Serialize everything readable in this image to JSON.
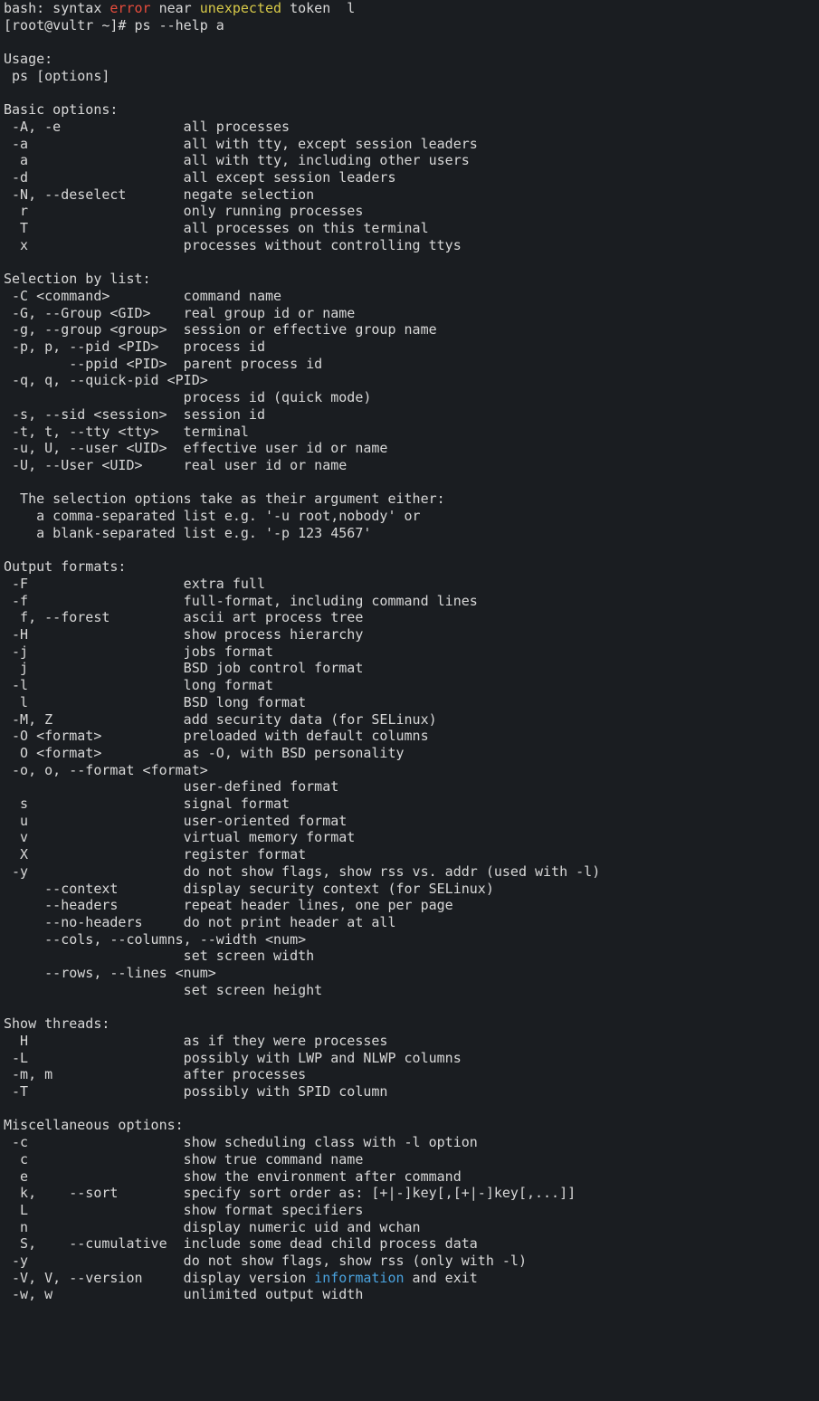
{
  "lines": [
    {
      "segments": [
        {
          "text": "bash: syntax "
        },
        {
          "text": "error",
          "class": "err-red"
        },
        {
          "text": " near "
        },
        {
          "text": "unexpected",
          "class": "warn-yellow"
        },
        {
          "text": " token  l"
        }
      ]
    },
    {
      "segments": [
        {
          "text": "[root@vultr ~]# ps --help a"
        }
      ]
    },
    {
      "segments": [
        {
          "text": ""
        }
      ]
    },
    {
      "segments": [
        {
          "text": "Usage:"
        }
      ]
    },
    {
      "segments": [
        {
          "text": " ps [options]"
        }
      ]
    },
    {
      "segments": [
        {
          "text": ""
        }
      ]
    },
    {
      "segments": [
        {
          "text": "Basic options:"
        }
      ]
    },
    {
      "segments": [
        {
          "text": " -A, -e               all processes"
        }
      ]
    },
    {
      "segments": [
        {
          "text": " -a                   all with tty, except session leaders"
        }
      ]
    },
    {
      "segments": [
        {
          "text": "  a                   all with tty, including other users"
        }
      ]
    },
    {
      "segments": [
        {
          "text": " -d                   all except session leaders"
        }
      ]
    },
    {
      "segments": [
        {
          "text": " -N, --deselect       negate selection"
        }
      ]
    },
    {
      "segments": [
        {
          "text": "  r                   only running processes"
        }
      ]
    },
    {
      "segments": [
        {
          "text": "  T                   all processes on this terminal"
        }
      ]
    },
    {
      "segments": [
        {
          "text": "  x                   processes without controlling ttys"
        }
      ]
    },
    {
      "segments": [
        {
          "text": ""
        }
      ]
    },
    {
      "segments": [
        {
          "text": "Selection by list:"
        }
      ]
    },
    {
      "segments": [
        {
          "text": " -C <command>         command name"
        }
      ]
    },
    {
      "segments": [
        {
          "text": " -G, --Group <GID>    real group id or name"
        }
      ]
    },
    {
      "segments": [
        {
          "text": " -g, --group <group>  session or effective group name"
        }
      ]
    },
    {
      "segments": [
        {
          "text": " -p, p, --pid <PID>   process id"
        }
      ]
    },
    {
      "segments": [
        {
          "text": "        --ppid <PID>  parent process id"
        }
      ]
    },
    {
      "segments": [
        {
          "text": " -q, q, --quick-pid <PID>"
        }
      ]
    },
    {
      "segments": [
        {
          "text": "                      process id (quick mode)"
        }
      ]
    },
    {
      "segments": [
        {
          "text": " -s, --sid <session>  session id"
        }
      ]
    },
    {
      "segments": [
        {
          "text": " -t, t, --tty <tty>   terminal"
        }
      ]
    },
    {
      "segments": [
        {
          "text": " -u, U, --user <UID>  effective user id or name"
        }
      ]
    },
    {
      "segments": [
        {
          "text": " -U, --User <UID>     real user id or name"
        }
      ]
    },
    {
      "segments": [
        {
          "text": ""
        }
      ]
    },
    {
      "segments": [
        {
          "text": "  The selection options take as their argument either:"
        }
      ]
    },
    {
      "segments": [
        {
          "text": "    a comma-separated list e.g. '-u root,nobody' or"
        }
      ]
    },
    {
      "segments": [
        {
          "text": "    a blank-separated list e.g. '-p 123 4567'"
        }
      ]
    },
    {
      "segments": [
        {
          "text": ""
        }
      ]
    },
    {
      "segments": [
        {
          "text": "Output formats:"
        }
      ]
    },
    {
      "segments": [
        {
          "text": " -F                   extra full"
        }
      ]
    },
    {
      "segments": [
        {
          "text": " -f                   full-format, including command lines"
        }
      ]
    },
    {
      "segments": [
        {
          "text": "  f, --forest         ascii art process tree"
        }
      ]
    },
    {
      "segments": [
        {
          "text": " -H                   show process hierarchy"
        }
      ]
    },
    {
      "segments": [
        {
          "text": " -j                   jobs format"
        }
      ]
    },
    {
      "segments": [
        {
          "text": "  j                   BSD job control format"
        }
      ]
    },
    {
      "segments": [
        {
          "text": " -l                   long format"
        }
      ]
    },
    {
      "segments": [
        {
          "text": "  l                   BSD long format"
        }
      ]
    },
    {
      "segments": [
        {
          "text": " -M, Z                add security data (for SELinux)"
        }
      ]
    },
    {
      "segments": [
        {
          "text": " -O <format>          preloaded with default columns"
        }
      ]
    },
    {
      "segments": [
        {
          "text": "  O <format>          as -O, with BSD personality"
        }
      ]
    },
    {
      "segments": [
        {
          "text": " -o, o, --format <format>"
        }
      ]
    },
    {
      "segments": [
        {
          "text": "                      user-defined format"
        }
      ]
    },
    {
      "segments": [
        {
          "text": "  s                   signal format"
        }
      ]
    },
    {
      "segments": [
        {
          "text": "  u                   user-oriented format"
        }
      ]
    },
    {
      "segments": [
        {
          "text": "  v                   virtual memory format"
        }
      ]
    },
    {
      "segments": [
        {
          "text": "  X                   register format"
        }
      ]
    },
    {
      "segments": [
        {
          "text": " -y                   do not show flags, show rss vs. addr (used with -l)"
        }
      ]
    },
    {
      "segments": [
        {
          "text": "     --context        display security context (for SELinux)"
        }
      ]
    },
    {
      "segments": [
        {
          "text": "     --headers        repeat header lines, one per page"
        }
      ]
    },
    {
      "segments": [
        {
          "text": "     --no-headers     do not print header at all"
        }
      ]
    },
    {
      "segments": [
        {
          "text": "     --cols, --columns, --width <num>"
        }
      ]
    },
    {
      "segments": [
        {
          "text": "                      set screen width"
        }
      ]
    },
    {
      "segments": [
        {
          "text": "     --rows, --lines <num>"
        }
      ]
    },
    {
      "segments": [
        {
          "text": "                      set screen height"
        }
      ]
    },
    {
      "segments": [
        {
          "text": ""
        }
      ]
    },
    {
      "segments": [
        {
          "text": "Show threads:"
        }
      ]
    },
    {
      "segments": [
        {
          "text": "  H                   as if they were processes"
        }
      ]
    },
    {
      "segments": [
        {
          "text": " -L                   possibly with LWP and NLWP columns"
        }
      ]
    },
    {
      "segments": [
        {
          "text": " -m, m                after processes"
        }
      ]
    },
    {
      "segments": [
        {
          "text": " -T                   possibly with SPID column"
        }
      ]
    },
    {
      "segments": [
        {
          "text": ""
        }
      ]
    },
    {
      "segments": [
        {
          "text": "Miscellaneous options:"
        }
      ]
    },
    {
      "segments": [
        {
          "text": " -c                   show scheduling class with -l option"
        }
      ]
    },
    {
      "segments": [
        {
          "text": "  c                   show true command name"
        }
      ]
    },
    {
      "segments": [
        {
          "text": "  e                   show the environment after command"
        }
      ]
    },
    {
      "segments": [
        {
          "text": "  k,    --sort        specify sort order as: [+|-]key[,[+|-]key[,...]]"
        }
      ]
    },
    {
      "segments": [
        {
          "text": "  L                   show format specifiers"
        }
      ]
    },
    {
      "segments": [
        {
          "text": "  n                   display numeric uid and wchan"
        }
      ]
    },
    {
      "segments": [
        {
          "text": "  S,    --cumulative  include some dead child process data"
        }
      ]
    },
    {
      "segments": [
        {
          "text": " -y                   do not show flags, show rss (only with -l)"
        }
      ]
    },
    {
      "segments": [
        {
          "text": " -V, V, --version     display version "
        },
        {
          "text": "information",
          "class": "link-blue"
        },
        {
          "text": " and exit"
        }
      ]
    },
    {
      "segments": [
        {
          "text": " -w, w                unlimited output width"
        }
      ]
    }
  ]
}
